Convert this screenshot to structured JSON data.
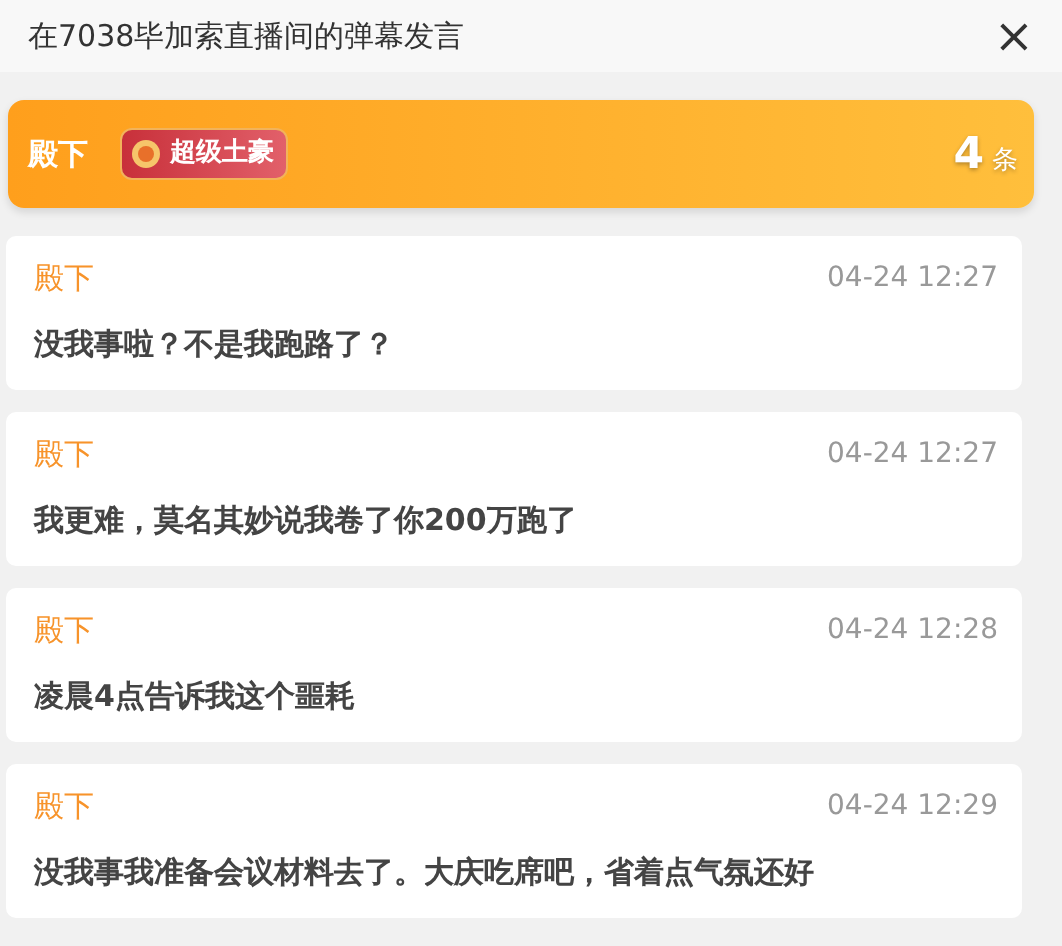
{
  "window": {
    "title": "在7038毕加索直播间的弹幕发言",
    "close": "×"
  },
  "summary": {
    "user": "殿下",
    "badge": "超级土豪",
    "count": "4",
    "unit": "条"
  },
  "messages": [
    {
      "user": "殿下",
      "time": "04-24 12:27",
      "text": "没我事啦？不是我跑路了？"
    },
    {
      "user": "殿下",
      "time": "04-24 12:27",
      "text": "我更难，莫名其妙说我卷了你200万跑了"
    },
    {
      "user": "殿下",
      "time": "04-24 12:28",
      "text": "凌晨4点告诉我这个噩耗"
    },
    {
      "user": "殿下",
      "time": "04-24 12:29",
      "text": "没我事我准备会议材料去了。大庆吃席吧，省着点气氛还好"
    }
  ]
}
